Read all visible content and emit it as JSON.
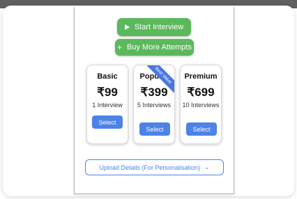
{
  "actions": {
    "start_interview": "Start Interview",
    "buy_more": "Buy More Attempts"
  },
  "plans": [
    {
      "name": "Basic",
      "price": "₹99",
      "feature": "1 Interview",
      "select_label": "Select"
    },
    {
      "name": "Popular",
      "price": "₹399",
      "feature": "5 Interviews",
      "select_label": "Select",
      "ribbon": "Best Value"
    },
    {
      "name": "Premium",
      "price": "₹699",
      "feature": "10 Interviews",
      "select_label": "Select"
    }
  ],
  "upload": {
    "label": "Upload Details (For Personalisation)"
  },
  "icons": {
    "start": "play-icon",
    "buy": "plus-icon",
    "upload_chevron": "chevron-down-icon"
  },
  "colors": {
    "green": "#5cb85c",
    "blue": "#4d82e6",
    "ribbon_blue": "#4a76de",
    "topbar": "#5f5f5f"
  }
}
